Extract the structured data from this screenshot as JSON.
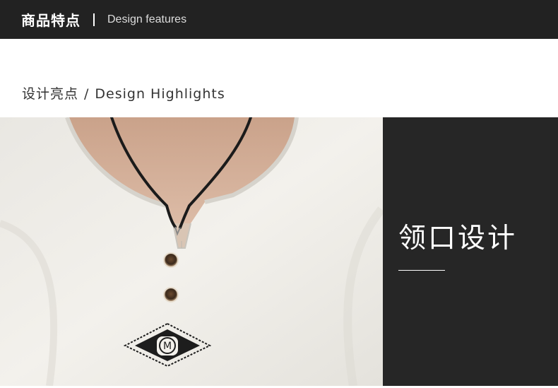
{
  "header": {
    "title_cn": "商品特点",
    "title_en": "Design features"
  },
  "section": {
    "title_cn": "设计亮点",
    "slash": "/",
    "title_en": "Design Highlights"
  },
  "feature": {
    "label": "领口设计"
  },
  "photo": {
    "emblem_letter": "M"
  },
  "colors": {
    "header_bg": "#222222",
    "panel_bg": "#262626",
    "shirt": "#f1efea",
    "skin": "#d8b7a2"
  }
}
